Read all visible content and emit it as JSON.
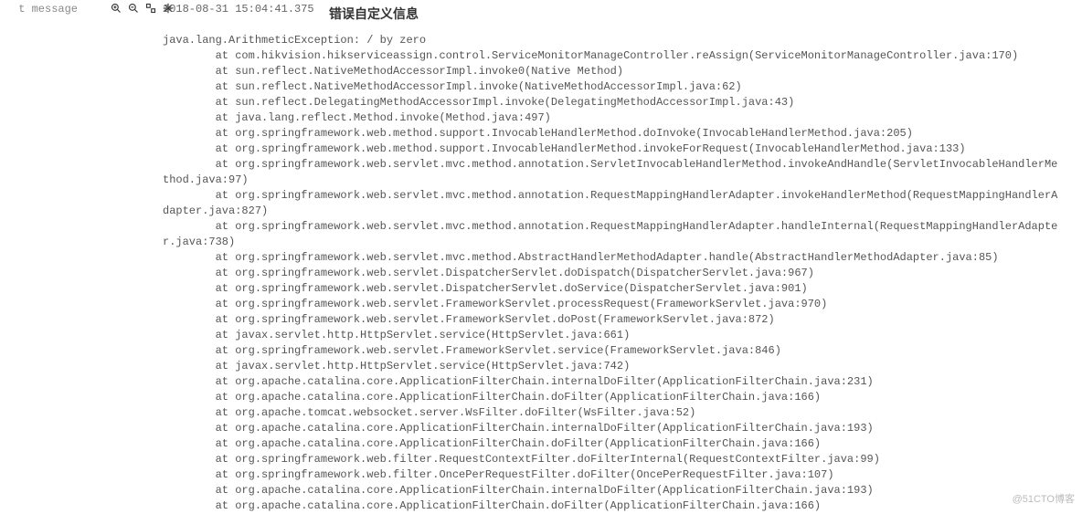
{
  "leftLabel": "t  message",
  "timestamp": "2018-08-31 15:04:41.375",
  "headline": "错误自定义信息",
  "watermark": "@51CTO博客",
  "icons": {
    "zoomIn": "zoom-in-icon",
    "zoomOut": "zoom-out-icon",
    "toggle": "toggle-icon",
    "config": "config-icon"
  },
  "stack": {
    "exception": "java.lang.ArithmeticException: / by zero",
    "lines": [
      "        at com.hikvision.hikserviceassign.control.ServiceMonitorManageController.reAssign(ServiceMonitorManageController.java:170)",
      "        at sun.reflect.NativeMethodAccessorImpl.invoke0(Native Method)",
      "        at sun.reflect.NativeMethodAccessorImpl.invoke(NativeMethodAccessorImpl.java:62)",
      "        at sun.reflect.DelegatingMethodAccessorImpl.invoke(DelegatingMethodAccessorImpl.java:43)",
      "        at java.lang.reflect.Method.invoke(Method.java:497)",
      "        at org.springframework.web.method.support.InvocableHandlerMethod.doInvoke(InvocableHandlerMethod.java:205)",
      "        at org.springframework.web.method.support.InvocableHandlerMethod.invokeForRequest(InvocableHandlerMethod.java:133)",
      "        at org.springframework.web.servlet.mvc.method.annotation.ServletInvocableHandlerMethod.invokeAndHandle(ServletInvocableHandlerMe",
      "thod.java:97)",
      "        at org.springframework.web.servlet.mvc.method.annotation.RequestMappingHandlerAdapter.invokeHandlerMethod(RequestMappingHandlerA",
      "dapter.java:827)",
      "        at org.springframework.web.servlet.mvc.method.annotation.RequestMappingHandlerAdapter.handleInternal(RequestMappingHandlerAdapte",
      "r.java:738)",
      "        at org.springframework.web.servlet.mvc.method.AbstractHandlerMethodAdapter.handle(AbstractHandlerMethodAdapter.java:85)",
      "        at org.springframework.web.servlet.DispatcherServlet.doDispatch(DispatcherServlet.java:967)",
      "        at org.springframework.web.servlet.DispatcherServlet.doService(DispatcherServlet.java:901)",
      "        at org.springframework.web.servlet.FrameworkServlet.processRequest(FrameworkServlet.java:970)",
      "        at org.springframework.web.servlet.FrameworkServlet.doPost(FrameworkServlet.java:872)",
      "        at javax.servlet.http.HttpServlet.service(HttpServlet.java:661)",
      "        at org.springframework.web.servlet.FrameworkServlet.service(FrameworkServlet.java:846)",
      "        at javax.servlet.http.HttpServlet.service(HttpServlet.java:742)",
      "        at org.apache.catalina.core.ApplicationFilterChain.internalDoFilter(ApplicationFilterChain.java:231)",
      "        at org.apache.catalina.core.ApplicationFilterChain.doFilter(ApplicationFilterChain.java:166)",
      "        at org.apache.tomcat.websocket.server.WsFilter.doFilter(WsFilter.java:52)",
      "        at org.apache.catalina.core.ApplicationFilterChain.internalDoFilter(ApplicationFilterChain.java:193)",
      "        at org.apache.catalina.core.ApplicationFilterChain.doFilter(ApplicationFilterChain.java:166)",
      "        at org.springframework.web.filter.RequestContextFilter.doFilterInternal(RequestContextFilter.java:99)",
      "        at org.springframework.web.filter.OncePerRequestFilter.doFilter(OncePerRequestFilter.java:107)",
      "        at org.apache.catalina.core.ApplicationFilterChain.internalDoFilter(ApplicationFilterChain.java:193)",
      "        at org.apache.catalina.core.ApplicationFilterChain.doFilter(ApplicationFilterChain.java:166)"
    ]
  }
}
